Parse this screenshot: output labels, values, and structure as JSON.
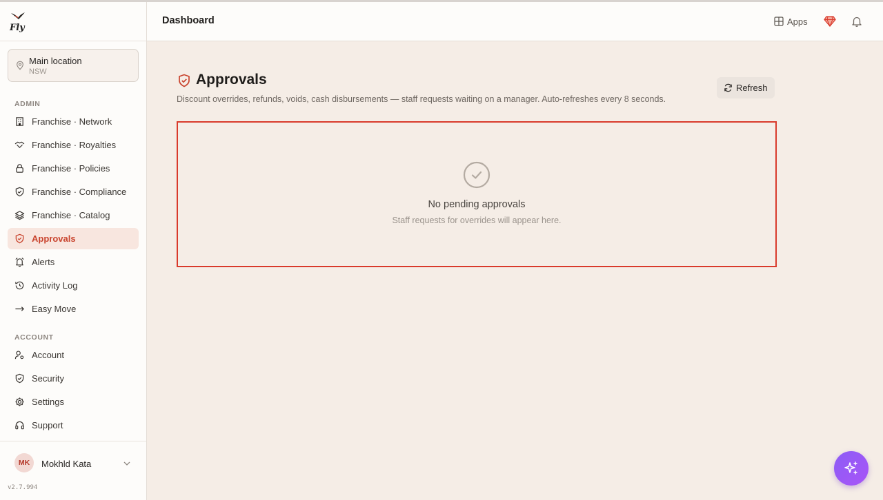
{
  "app": {
    "logo_text": "Fly",
    "version": "v2.7.994"
  },
  "location": {
    "name": "Main location",
    "region": "NSW"
  },
  "sidebar": {
    "admin_label": "ADMIN",
    "admin_items": [
      {
        "label": "Franchise · Network",
        "icon": "building-icon"
      },
      {
        "label": "Franchise · Royalties",
        "icon": "handshake-icon"
      },
      {
        "label": "Franchise · Policies",
        "icon": "lock-icon"
      },
      {
        "label": "Franchise · Compliance",
        "icon": "shield-check-icon"
      },
      {
        "label": "Franchise · Catalog",
        "icon": "layers-icon"
      },
      {
        "label": "Approvals",
        "icon": "shield-check-icon",
        "active": true
      },
      {
        "label": "Alerts",
        "icon": "bell-icon"
      },
      {
        "label": "Activity Log",
        "icon": "history-icon"
      },
      {
        "label": "Easy Move",
        "icon": "arrow-right-icon"
      }
    ],
    "account_label": "ACCOUNT",
    "account_items": [
      {
        "label": "Account",
        "icon": "user-cog-icon"
      },
      {
        "label": "Security",
        "icon": "shield-icon"
      },
      {
        "label": "Settings",
        "icon": "gear-icon"
      },
      {
        "label": "Support",
        "icon": "headset-icon"
      }
    ]
  },
  "user": {
    "initials": "MK",
    "name": "Mokhld Kata"
  },
  "header": {
    "title": "Dashboard",
    "apps_label": "Apps"
  },
  "main": {
    "title": "Approvals",
    "description": "Discount overrides, refunds, voids, cash disbursements — staff requests waiting on a manager. Auto-refreshes every 8 seconds.",
    "refresh_label": "Refresh",
    "empty_title": "No pending approvals",
    "empty_subtitle": "Staff requests for overrides will appear here."
  },
  "colors": {
    "accent": "#c9442e",
    "background": "#f5ede6",
    "fab": "#9b5cf6",
    "highlight_border": "#d93a2b"
  }
}
